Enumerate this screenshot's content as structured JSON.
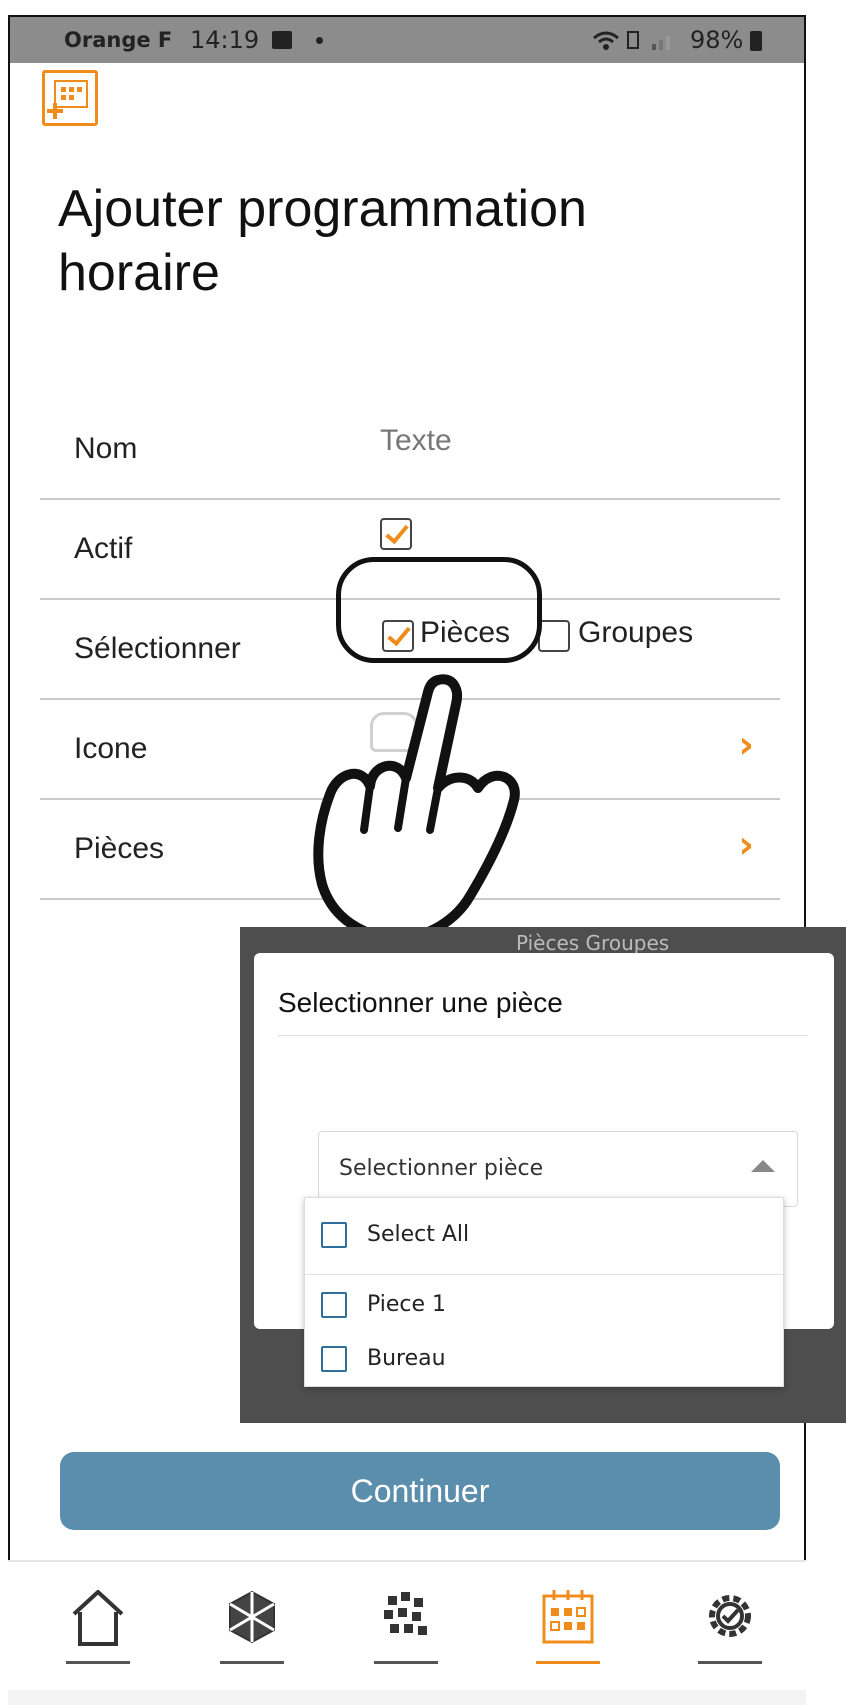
{
  "status_bar": {
    "carrier": "Orange F",
    "time": "14:19",
    "battery": "98%"
  },
  "page": {
    "title": "Ajouter programmation horaire"
  },
  "form": {
    "name": {
      "label": "Nom",
      "placeholder": "Texte"
    },
    "active": {
      "label": "Actif",
      "checked": true
    },
    "select": {
      "label": "Sélectionner",
      "options": [
        {
          "label": "Pièces",
          "checked": true
        },
        {
          "label": "Groupes",
          "checked": false
        }
      ]
    },
    "icon": {
      "label": "Icone"
    },
    "rooms": {
      "label": "Pièces"
    }
  },
  "modal": {
    "behind_text": "Pièces  Groupes",
    "title": "Selectionner une pièce",
    "select_placeholder": "Selectionner pièce",
    "items": [
      {
        "label": "Select All",
        "checked": false
      },
      {
        "label": "Piece 1",
        "checked": false
      },
      {
        "label": "Bureau",
        "checked": false
      }
    ]
  },
  "continue_button": {
    "label": "Continuer"
  },
  "bottom_nav": {
    "items": [
      {
        "icon": "home-icon",
        "active": false
      },
      {
        "icon": "cube-icon",
        "active": false
      },
      {
        "icon": "grid-icon",
        "active": false
      },
      {
        "icon": "calendar-icon",
        "active": true
      },
      {
        "icon": "settings-gear-icon",
        "active": false
      }
    ]
  },
  "colors": {
    "accent": "#f08c1c",
    "button": "#5b8dac",
    "status_bar": "#8c8c8c",
    "modal_overlay": "#4e4e4e"
  }
}
